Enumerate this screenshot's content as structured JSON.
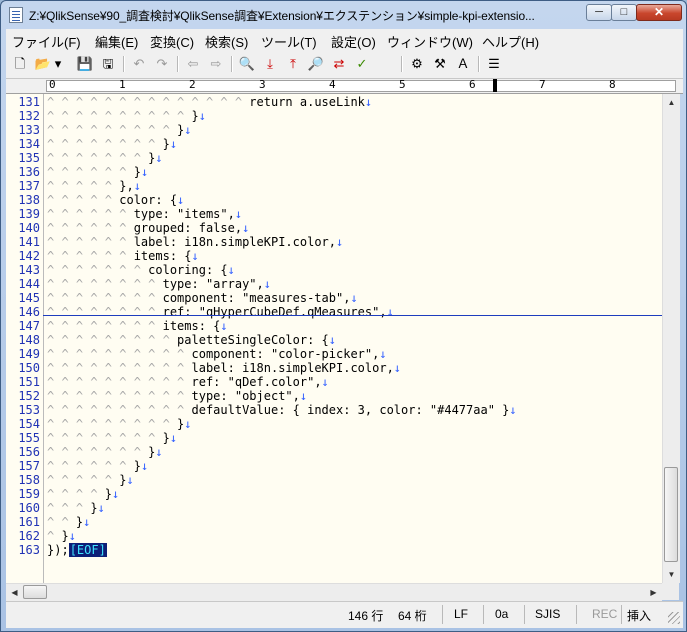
{
  "window": {
    "title": "Z:¥QlikSense¥90_調査検討¥QlikSense調査¥Extension¥エクステンション¥simple-kpi-extensio...",
    "min_label": "─",
    "max_label": "□",
    "close_label": "✕"
  },
  "menu": [
    {
      "label": "ファイル(F)"
    },
    {
      "label": "編集(E)"
    },
    {
      "label": "変換(C)"
    },
    {
      "label": "検索(S)"
    },
    {
      "label": "ツール(T)"
    },
    {
      "label": "設定(O)"
    },
    {
      "label": "ウィンドウ(W)"
    },
    {
      "label": "ヘルプ(H)"
    }
  ],
  "toolbar": [
    {
      "icon": "new-file-icon",
      "glyph": "🗋"
    },
    {
      "icon": "open-folder-icon",
      "glyph": "📂"
    },
    {
      "icon": "dropdown-icon",
      "glyph": "▾"
    },
    {
      "icon": "save-icon",
      "glyph": "💾"
    },
    {
      "icon": "save-all-icon",
      "glyph": "🖫"
    },
    {
      "icon": "undo-icon",
      "glyph": "↶"
    },
    {
      "icon": "redo-icon",
      "glyph": "↷"
    },
    {
      "icon": "nav-back-icon",
      "glyph": "⇦"
    },
    {
      "icon": "nav-forward-icon",
      "glyph": "⇨"
    },
    {
      "icon": "search-icon",
      "glyph": "🔍"
    },
    {
      "icon": "search-down-icon",
      "glyph": "⤓"
    },
    {
      "icon": "search-up-icon",
      "glyph": "⤒"
    },
    {
      "icon": "grep-icon",
      "glyph": "🔎"
    },
    {
      "icon": "replace-icon",
      "glyph": "⇄"
    },
    {
      "icon": "mark-icon",
      "glyph": "✓"
    },
    {
      "icon": "settings-common-icon",
      "glyph": "⚙"
    },
    {
      "icon": "settings-type-icon",
      "glyph": "⚒"
    },
    {
      "icon": "settings-font-icon",
      "glyph": "Ａ"
    },
    {
      "icon": "outline-icon",
      "glyph": "☰"
    }
  ],
  "ruler": {
    "labels": [
      "0",
      "1",
      "2",
      "3",
      "4",
      "5",
      "6",
      "7",
      "8"
    ]
  },
  "editor": {
    "eof_label": "[EOF]",
    "lines": [
      {
        "num": "131",
        "indent": "^ ^ ^ ^ ^ ^ ^ ^ ^ ^ ^ ^ ^ ^ ",
        "text": "return a.useLink",
        "eol": "↓"
      },
      {
        "num": "132",
        "indent": "^ ^ ^ ^ ^ ^ ^ ^ ^ ^ ",
        "text": "}",
        "eol": "↓"
      },
      {
        "num": "133",
        "indent": "^ ^ ^ ^ ^ ^ ^ ^ ^ ",
        "text": "}",
        "eol": "↓"
      },
      {
        "num": "134",
        "indent": "^ ^ ^ ^ ^ ^ ^ ^ ",
        "text": "}",
        "eol": "↓"
      },
      {
        "num": "135",
        "indent": "^ ^ ^ ^ ^ ^ ^ ",
        "text": "}",
        "eol": "↓"
      },
      {
        "num": "136",
        "indent": "^ ^ ^ ^ ^ ^ ",
        "text": "}",
        "eol": "↓"
      },
      {
        "num": "137",
        "indent": "^ ^ ^ ^ ^ ",
        "text": "},",
        "eol": "↓"
      },
      {
        "num": "138",
        "indent": "^ ^ ^ ^ ^ ",
        "text": "color: {",
        "eol": "↓"
      },
      {
        "num": "139",
        "indent": "^ ^ ^ ^ ^ ^ ",
        "text": "type: \"items\",",
        "eol": "↓"
      },
      {
        "num": "140",
        "indent": "^ ^ ^ ^ ^ ^ ",
        "text": "grouped: false,",
        "eol": "↓"
      },
      {
        "num": "141",
        "indent": "^ ^ ^ ^ ^ ^ ",
        "text": "label: i18n.simpleKPI.color,",
        "eol": "↓"
      },
      {
        "num": "142",
        "indent": "^ ^ ^ ^ ^ ^ ",
        "text": "items: {",
        "eol": "↓"
      },
      {
        "num": "143",
        "indent": "^ ^ ^ ^ ^ ^ ^ ",
        "text": "coloring: {",
        "eol": "↓"
      },
      {
        "num": "144",
        "indent": "^ ^ ^ ^ ^ ^ ^ ^ ",
        "text": "type: \"array\",",
        "eol": "↓"
      },
      {
        "num": "145",
        "indent": "^ ^ ^ ^ ^ ^ ^ ^ ",
        "text": "component: \"measures-tab\",",
        "eol": "↓"
      },
      {
        "num": "146",
        "indent": "^ ^ ^ ^ ^ ^ ^ ^ ",
        "text": "ref: \"qHyperCubeDef.qMeasures\",",
        "eol": "↓"
      },
      {
        "num": "147",
        "indent": "^ ^ ^ ^ ^ ^ ^ ^ ",
        "text": "items: {",
        "eol": "↓"
      },
      {
        "num": "148",
        "indent": "^ ^ ^ ^ ^ ^ ^ ^ ^ ",
        "text": "paletteSingleColor: {",
        "eol": "↓"
      },
      {
        "num": "149",
        "indent": "^ ^ ^ ^ ^ ^ ^ ^ ^ ^ ",
        "text": "component: \"color-picker\",",
        "eol": "↓"
      },
      {
        "num": "150",
        "indent": "^ ^ ^ ^ ^ ^ ^ ^ ^ ^ ",
        "text": "label: i18n.simpleKPI.color,",
        "eol": "↓"
      },
      {
        "num": "151",
        "indent": "^ ^ ^ ^ ^ ^ ^ ^ ^ ^ ",
        "text": "ref: \"qDef.color\",",
        "eol": "↓"
      },
      {
        "num": "152",
        "indent": "^ ^ ^ ^ ^ ^ ^ ^ ^ ^ ",
        "text": "type: \"object\",",
        "eol": "↓"
      },
      {
        "num": "153",
        "indent": "^ ^ ^ ^ ^ ^ ^ ^ ^ ^ ",
        "text": "defaultValue: { index: 3, color: \"#4477aa\" }",
        "eol": "↓"
      },
      {
        "num": "154",
        "indent": "^ ^ ^ ^ ^ ^ ^ ^ ^ ",
        "text": "}",
        "eol": "↓"
      },
      {
        "num": "155",
        "indent": "^ ^ ^ ^ ^ ^ ^ ^ ",
        "text": "}",
        "eol": "↓"
      },
      {
        "num": "156",
        "indent": "^ ^ ^ ^ ^ ^ ^ ",
        "text": "}",
        "eol": "↓"
      },
      {
        "num": "157",
        "indent": "^ ^ ^ ^ ^ ^ ",
        "text": "}",
        "eol": "↓"
      },
      {
        "num": "158",
        "indent": "^ ^ ^ ^ ^ ",
        "text": "}",
        "eol": "↓"
      },
      {
        "num": "159",
        "indent": "^ ^ ^ ^ ",
        "text": "}",
        "eol": "↓"
      },
      {
        "num": "160",
        "indent": "^ ^ ^ ",
        "text": "}",
        "eol": "↓"
      },
      {
        "num": "161",
        "indent": "^ ^ ",
        "text": "}",
        "eol": "↓"
      },
      {
        "num": "162",
        "indent": "^ ",
        "text": "}",
        "eol": "↓"
      },
      {
        "num": "163",
        "indent": "",
        "text": "});",
        "eol": ""
      }
    ]
  },
  "status": {
    "line": "146 行",
    "col": "64 桁",
    "eol_type": "LF",
    "char_code": "0a",
    "encoding": "SJIS",
    "rec": "REC",
    "mode": "挿入"
  }
}
